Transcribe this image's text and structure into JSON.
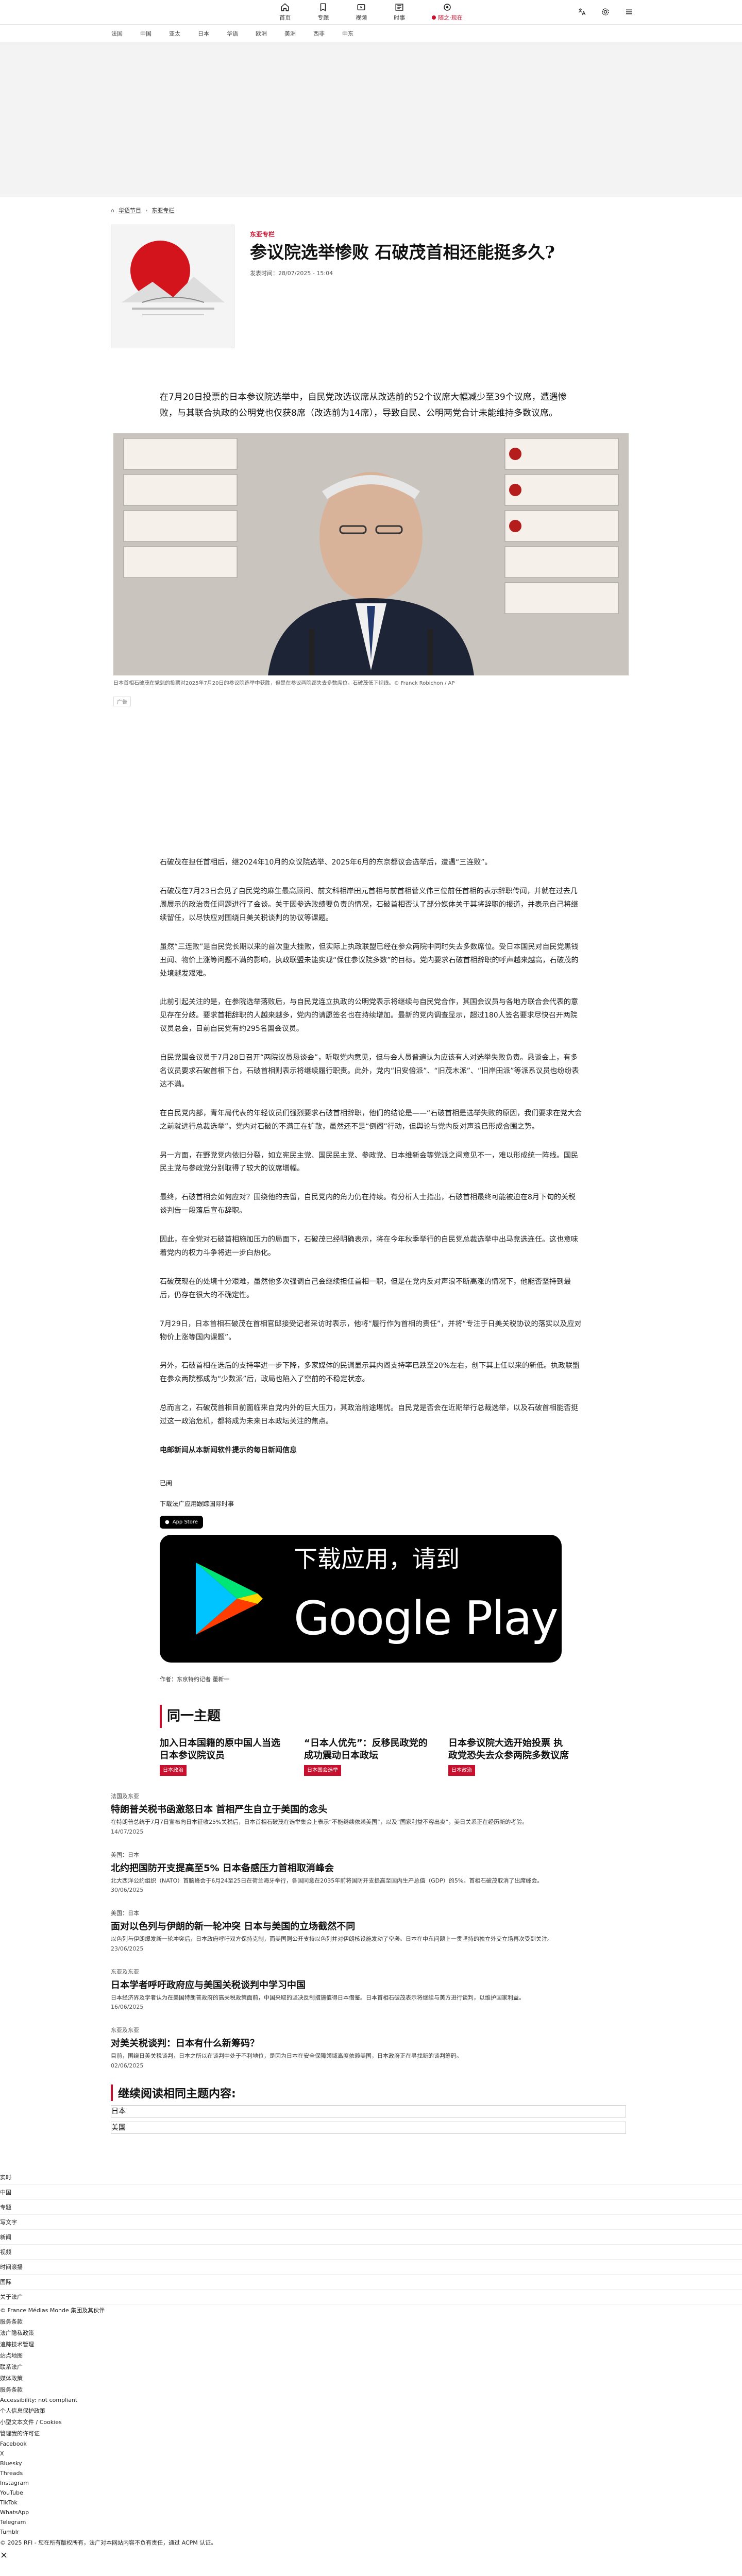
{
  "nav": {
    "items": [
      {
        "label": "首页"
      },
      {
        "label": "专题"
      },
      {
        "label": "视频"
      },
      {
        "label": "时事"
      }
    ],
    "live": "随之·现在"
  },
  "secnav": [
    "法国",
    "中国",
    "亚太",
    "日本",
    "华语",
    "欧洲",
    "美洲",
    "西非",
    "中东"
  ],
  "breadcrumb": {
    "home": "法广",
    "a": "华语节目",
    "b": "东亚专栏"
  },
  "article": {
    "kicker": "东亚专栏",
    "title": "参议院选举惨败 石破茂首相还能挺多久?",
    "date": "发表时间：28/07/2025 - 15:04",
    "lead": "在7月20日投票的日本参议院选举中，自民党改选议席从改选前的52个议席大幅减少至39个议席，遭遇惨败，与其联合执政的公明党也仅获8席（改选前为14席），导致自民、公明两党合计未能维持多数议席。",
    "caption": "日本首相石破茂在党魁的投票对2025年7月20日的参议院选举中获胜，但是在参议两院都失去多数席位。石破茂低下视线。© Franck Robichon / AP",
    "ad": "广告",
    "paragraphs": [
      "石破茂在担任首相后，继2024年10月的众议院选举、2025年6月的东京都议会选举后，遭遇“三连败”。",
      "石破茂在7月23日会见了自民党的麻生最高顾问、前文科相岸田元首相与前首相菅义伟三位前任首相的表示辞职传闻，并就在过去几周展示的政治责任问题进行了会谈。关于因参选败绩要负责的情况，石破首相否认了部分媒体关于其将辞职的报道，并表示自己将继续留任，以尽快应对围绕日美关税谈判的协议等课题。",
      "虽然“三连败”是自民党长期以来的首次重大挫败，但实际上执政联盟已经在参众两院中同时失去多数席位。受日本国民对自民党黑钱丑闻、物价上涨等问题不满的影响，执政联盟未能实现“保住参议院多数”的目标。党内要求石破首相辞职的呼声越来越高，石破茂的处境越发艰难。",
      "此前引起关注的是，在参院选举落败后，与自民党连立执政的公明党表示将继续与自民党合作，其国会议员与各地方联合会代表的意见存在分歧。要求首相辞职的人越来越多，党内的请愿签名也在持续增加。最新的党内调查显示，超过180人签名要求尽快召开两院议员总会，目前自民党有约295名国会议员。",
      "自民党国会议员于7月28日召开“两院议员恳谈会”，听取党内意见，但与会人员普遍认为应该有人对选举失败负责。恳谈会上，有多名议员要求石破首相下台，石破首相则表示将继续履行职责。此外，党内“旧安倍派”、“旧茂木派”、“旧岸田派”等派系议员也纷纷表达不满。",
      "在自民党内部，青年局代表的年轻议员们强烈要求石破首相辞职，他们的结论是——“石破首相是选举失败的原因，我们要求在党大会之前就进行总裁选举”。党内对石破的不满正在扩散，虽然还不是“倒阁”行动，但舆论与党内反对声浪已形成合围之势。",
      "另一方面，在野党党内依旧分裂，如立宪民主党、国民民主党、参政党、日本维新会等党派之间意见不一，难以形成统一阵线。国民民主党与参政党分别取得了较大的议席增幅。",
      "最终，石破首相会如何应对？围绕他的去留，自民党内的角力仍在持续。有分析人士指出，石破首相最终可能被迫在8月下旬的关税谈判告一段落后宣布辞职。",
      "因此，在全党对石破首相施加压力的局面下，石破茂已经明确表示，将在今年秋季举行的自民党总裁选举中出马竞选连任。这也意味着党内的权力斗争将进一步白热化。",
      "石破茂现在的处境十分艰难，虽然他多次强调自己会继续担任首相一职，但是在党内反对声浪不断高涨的情况下，他能否坚持到最后，仍存在很大的不确定性。",
      "7月29日，日本首相石破茂在首相官邸接受记者采访时表示，他将“履行作为首相的责任”，并将“专注于日美关税协议的落实以及应对物价上涨等国内课题”。",
      "另外，石破首相在选后的支持率进一步下降，多家媒体的民调显示其内阁支持率已跌至20%左右，创下其上任以来的新低。执政联盟在参众两院都成为“少数派”后，政局也陷入了空前的不稳定状态。",
      "总而言之，石破茂首相目前面临来自党内外的巨大压力，其政治前途堪忧。自民党是否会在近期举行总裁选举，以及石破首相能否挺过这一政治危机，都将成为未来日本政坛关注的焦点。"
    ],
    "byline_note": "电邮新闻从本新闻软件提示的每日新闻信息",
    "ok": "已阅",
    "download": "下载法广应用跟踪国际时事",
    "appstore": "App Store",
    "gp_small": "下载应用，请到",
    "gp_big": "Google Play",
    "author": "作者：东京特约记者 董新一"
  },
  "same_topic": {
    "heading": "同一主题",
    "items": [
      {
        "title": "加入日本国籍的原中国人当选日本参议院议员",
        "tag": "日本政治"
      },
      {
        "title": "“日本人优先”：反移民政党的成功震动日本政坛",
        "tag": "日本国会选举"
      },
      {
        "title": "日本参议院大选开始投票 执政党恐失去众参两院多数议席",
        "tag": "日本政治"
      }
    ]
  },
  "news": [
    {
      "cat": "法国及东亚",
      "title": "特朗普关税书函激怒日本 首相严生自立于美国的念头",
      "desc": "在特朗普总统于7月7日宣布向日本征收25%关税后，日本首相石破茂在选举集会上表示“不能继续依赖美国”，以及“国家利益不容出卖”，美日关系正在经历新的考验。",
      "time": "14/07/2025"
    },
    {
      "cat": "美国：日本",
      "title": "北约把国防开支提高至5% 日本备感压力首相取消峰会",
      "desc": "北大西洋公约组织（NATO）首脑峰会于6月24至25日在荷兰海牙举行，各国同意在2035年前将国防开支提高至国内生产总值（GDP）的5%。首相石破茂取消了出席峰会。",
      "time": "30/06/2025"
    },
    {
      "cat": "美国：日本",
      "title": "面对以色列与伊朗的新一轮冲突 日本与美国的立场截然不同",
      "desc": "以色列与伊朗爆发新一轮冲突后，日本政府呼吁双方保持克制，而美国则公开支持以色列并对伊朗核设施发动了空袭。日本在中东问题上一贯坚持的独立外交立场再次受到关注。",
      "time": "23/06/2025"
    },
    {
      "cat": "东亚及东亚",
      "title": "日本学者呼吁政府应与美国关税谈判中学习中国",
      "desc": "日本经济界及学者认为在美国特朗普政府的高关税政策面前，中国采取的坚决反制措施值得日本借鉴。日本首相石破茂表示将继续与美方进行谈判，以维护国家利益。",
      "time": "16/06/2025"
    },
    {
      "cat": "东亚及东亚",
      "title": "对美关税谈判：日本有什么新筹码？",
      "desc": "目前，围绕日美关税谈判，日本之所以在谈判中处于不利地位，是因为日本在安全保障领域高度依赖美国，日本政府正在寻找新的谈判筹码。",
      "time": "02/06/2025"
    }
  ],
  "continue": {
    "heading": "继续阅读相同主题内容:",
    "boxes": [
      "日本",
      "美国"
    ]
  },
  "footer": {
    "links": [
      "实时",
      "中国",
      "专题",
      "写文字",
      "新闻",
      "视频",
      "时间滚播",
      "国际",
      "关于法广"
    ],
    "plain": [
      "© France Médias Monde 集团及其伙伴",
      "服务条款",
      "法广隐私政策",
      "追踪技术管理",
      "站点地图",
      "联系法广",
      "媒体政策",
      "服务条款",
      "Accessibility: not compliant",
      "个人信息保护政策",
      "小型文本文件 / Cookies",
      "管理我的许可证",
      "Facebook",
      "X",
      "Bluesky",
      "Threads",
      "Instagram",
      "YouTube",
      "TikTok",
      "WhatsApp",
      "Telegram",
      "Tumblr"
    ],
    "copy": "© 2025 RFI - 您在所有版权所有，法广对本网站内容不负有责任，通过 ACPM 认证。",
    "close_label": "×"
  },
  "colors": {
    "accent": "#c8102e"
  }
}
